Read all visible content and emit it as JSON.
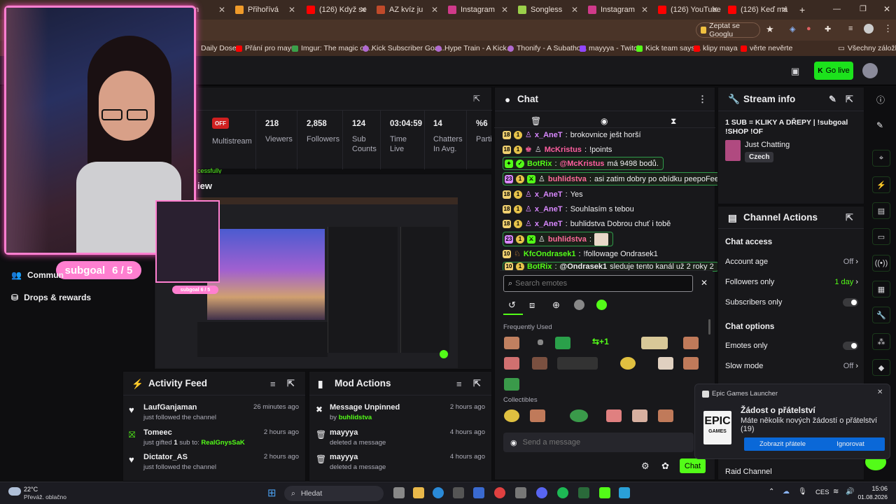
{
  "browser": {
    "tabs": [
      {
        "label": "n",
        "fav": "#e8dcd4"
      },
      {
        "label": "Přihořívá",
        "fav": "#f09b2a"
      },
      {
        "label": "(126) Když se",
        "fav": "#ff0000"
      },
      {
        "label": "AZ kvíz ju",
        "fav": "#c04a2a"
      },
      {
        "label": "Instagram",
        "fav": "#d03a8a"
      },
      {
        "label": "Songless",
        "fav": "#9bd04a"
      },
      {
        "label": "Instagram",
        "fav": "#d03a8a"
      },
      {
        "label": "(126) YouTube",
        "fav": "#ff0000"
      },
      {
        "label": "(126) Keď má",
        "fav": "#ff0000"
      }
    ],
    "new_tab": "+",
    "google_button": "Zeptat se Googlu",
    "bookmarks": [
      {
        "label": "Daily Dose",
        "fav": "#6a6a6a"
      },
      {
        "label": "Přání pro mayu",
        "fav": "#ff0000"
      },
      {
        "label": "Imgur: The magic of...",
        "fav": "#3aa04a"
      },
      {
        "label": "Kick Subscriber Goa...",
        "fav": "#b06ad0"
      },
      {
        "label": "Hype Train - A Kick...",
        "fav": "#b06ad0"
      },
      {
        "label": "Thonify - A Subatho...",
        "fav": "#b06ad0"
      },
      {
        "label": "mayyya - Twitch",
        "fav": "#9146ff"
      },
      {
        "label": "Kick team says...",
        "fav": "#53fc18"
      },
      {
        "label": "klipy maya",
        "fav": "#ff0000"
      },
      {
        "label": "věrte nevěrte",
        "fav": "#ff0000"
      }
    ],
    "all_bookmarks": "Všechny záložky"
  },
  "header": {
    "go_live": "Go live"
  },
  "webcam": {
    "subgoal_text": "subgoal",
    "subgoal_count": "6 / 5"
  },
  "stats": {
    "multistream_badge": "OFF",
    "multistream": "Multistream",
    "viewers_value": "218",
    "viewers": "Viewers",
    "followers_value": "2,858",
    "followers": "Followers",
    "subs_value": "124",
    "subs": "Sub Counts",
    "time_value": "03:04:59",
    "time": "Time Live",
    "chatters_value": "14",
    "chatters": "Chatters In Avg.",
    "part_value": "%6",
    "part": "Parti"
  },
  "preview": {
    "title": "iew",
    "partial_text": "cessfully"
  },
  "left_nav": {
    "community": "Commun",
    "drops": "Drops & rewards"
  },
  "activity": {
    "title": "Activity Feed",
    "items": [
      {
        "name": "LaufGanjaman",
        "sub": "just followed the channel",
        "time": "26 minutes ago"
      },
      {
        "name": "Tomeec",
        "sub_pre": "just gifted ",
        "gift_count": "1",
        "sub_mid": " sub to: ",
        "target": "RealGnysSaK",
        "time": "2 hours ago"
      },
      {
        "name": "Dictator_AS",
        "sub": "just followed the channel",
        "time": "2 hours ago"
      }
    ]
  },
  "mod": {
    "title": "Mod Actions",
    "items": [
      {
        "name": "Message Unpinned",
        "sub_pre": "by ",
        "by": "buhlidstva",
        "time": "2 hours ago"
      },
      {
        "name": "mayyya",
        "sub": "deleted a message",
        "time": "4 hours ago"
      },
      {
        "name": "mayyya",
        "sub": "deleted a message",
        "time": "4 hours ago"
      }
    ]
  },
  "chat": {
    "title": "Chat",
    "messages": [
      {
        "lvl": "18",
        "user": "x_AneT",
        "color": "#d988ff",
        "text": "brokovnice ješt horší"
      },
      {
        "lvl": "18",
        "user": "McKristus",
        "color": "#ff5fa0",
        "text": "!points"
      },
      {
        "lvl": "",
        "user": "BotRix",
        "color": "#53fc18",
        "text_pre": "",
        "mention": "@McKristus",
        "text": " má 9498 bodů."
      },
      {
        "lvl": "23",
        "user": "buhlidstva",
        "color": "#ff6a9a",
        "text": "asi zatim dobry po obídku peepoFeet"
      },
      {
        "lvl": "18",
        "user": "x_AneT",
        "color": "#d988ff",
        "text": "Yes"
      },
      {
        "lvl": "18",
        "user": "x_AneT",
        "color": "#d988ff",
        "text": "Souhlasím s tebou"
      },
      {
        "lvl": "18",
        "user": "x_AneT",
        "color": "#d988ff",
        "text": "buhlidstva Dobrou chuť i tobě"
      },
      {
        "lvl": "23",
        "user": "buhlidstva",
        "color": "#ff6a9a",
        "text": ""
      },
      {
        "lvl": "10",
        "user": "KfcOndrasek1",
        "color": "#53fc18",
        "text": "!followage Ondrasek1"
      },
      {
        "lvl": "10",
        "user": "BotRix",
        "color": "#53fc18",
        "mention": "@Ondrasek1",
        "text": " sleduje tento kanál už 2 roky 2"
      }
    ],
    "emote_search_placeholder": "Search emotes",
    "frequently_used": "Frequently Used",
    "collectibles": "Collectibles",
    "send_placeholder": "Send a message",
    "chat_button": "Chat"
  },
  "stream_info": {
    "title": "Stream info",
    "stream_title": "1 SUB = KLIKY A DŘEPY | !subgoal !SHOP !OF",
    "category": "Just Chatting",
    "tag": "Czech"
  },
  "channel_actions": {
    "title": "Channel Actions",
    "chat_access": "Chat access",
    "account_age": "Account age",
    "account_age_value": "Off",
    "followers_only": "Followers only",
    "followers_only_value": "1 day",
    "subscribers_only": "Subscribers only",
    "chat_options": "Chat options",
    "emotes_only": "Emotes only",
    "slow_mode": "Slow mode",
    "slow_mode_value": "Off",
    "raid": "Raid Channel"
  },
  "notification": {
    "app": "Epic Games Launcher",
    "logo_text_1": "EPIC",
    "logo_text_2": "GAMES",
    "title": "Žádost o přátelství",
    "body": "Máte několik nových žádostí o přátelství (19)",
    "show_button": "Zobrazit přátele",
    "ignore_button": "Ignorovat"
  },
  "taskbar": {
    "temp": "22°C",
    "weather": "Převáž. oblačno",
    "search": "Hledat",
    "lang": "CES",
    "time": "15:06",
    "date": "01.08.2026"
  }
}
